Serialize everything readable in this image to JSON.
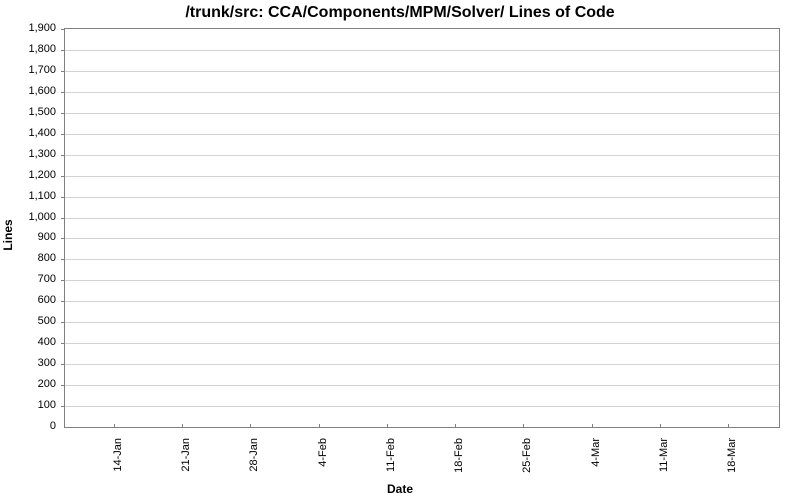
{
  "chart_data": {
    "type": "line",
    "title": "/trunk/src: CCA/Components/MPM/Solver/ Lines of Code",
    "xlabel": "Date",
    "ylabel": "Lines",
    "x_categories": [
      "14-Jan",
      "21-Jan",
      "28-Jan",
      "4-Feb",
      "11-Feb",
      "18-Feb",
      "25-Feb",
      "4-Mar",
      "11-Mar",
      "18-Mar"
    ],
    "y_ticks": [
      0,
      100,
      200,
      300,
      400,
      500,
      600,
      700,
      800,
      900,
      "1,000",
      "1,100",
      "1,200",
      "1,300",
      "1,400",
      "1,500",
      "1,600",
      "1,700",
      "1,800",
      "1,900"
    ],
    "ylim": [
      0,
      1900
    ],
    "series": [
      {
        "name": "Lines of Code",
        "x": [
          "14-Jan",
          "21-Jan",
          "28-Jan",
          "4-Feb",
          "11-Feb",
          "18-Feb",
          "25-Feb",
          "4-Mar",
          "11-Mar",
          "18-Mar"
        ],
        "y": []
      }
    ],
    "note": "No data points visible; chart shows axes and gridlines only."
  }
}
